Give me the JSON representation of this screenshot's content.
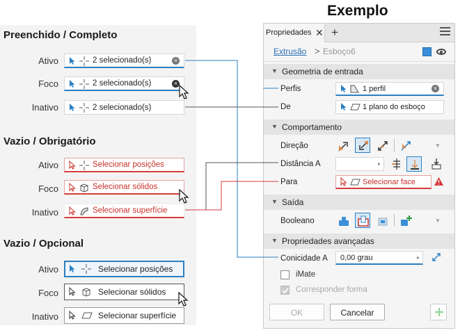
{
  "left": {
    "sections": [
      {
        "title": "Preenchido / Completo",
        "rows": [
          {
            "state": "Ativo",
            "text": "2 selecionado(s)"
          },
          {
            "state": "Foco",
            "text": "2 selecionado(s)"
          },
          {
            "state": "Inativo",
            "text": "2 selecionado(s)"
          }
        ]
      },
      {
        "title": "Vazio / Obrigatório",
        "rows": [
          {
            "state": "Ativo",
            "text": "Selecionar posições"
          },
          {
            "state": "Foco",
            "text": "Selecionar sólidos"
          },
          {
            "state": "Inativo",
            "text": "Selecionar superfície"
          }
        ]
      },
      {
        "title": "Vazio / Opcional",
        "rows": [
          {
            "state": "Ativo",
            "text": "Selecionar posições"
          },
          {
            "state": "Foco",
            "text": "Selecionar sólidos"
          },
          {
            "state": "Inativo",
            "text": "Selecionar superfície"
          }
        ]
      }
    ]
  },
  "example_title": "Exemplo",
  "panel": {
    "tab_label": "Propriedades",
    "breadcrumb": {
      "link": "Extrusão",
      "separator": ">",
      "current": "Esboço6"
    },
    "groups": {
      "input": "Geometria de entrada",
      "behavior": "Comportamento",
      "output": "Saída",
      "advanced": "Propriedades avançadas"
    },
    "fields": {
      "perfis_label": "Perfis",
      "perfis_value": "1 perfil",
      "de_label": "De",
      "de_value": "1 plano do esboço",
      "direcao_label": "Direção",
      "distancia_label": "Distância A",
      "para_label": "Para",
      "para_value": "Selecionar face",
      "booleano_label": "Booleano",
      "conicidade_label": "Conicidade A",
      "conicidade_value": "0,00 grau",
      "imate_label": "iMate",
      "corresponder_label": "Corresponder forma"
    },
    "buttons": {
      "ok": "OK",
      "cancel": "Cancelar"
    }
  },
  "colors": {
    "accent": "#2a7fc1",
    "error": "#d63a3a",
    "link": "#2a6fb3"
  }
}
